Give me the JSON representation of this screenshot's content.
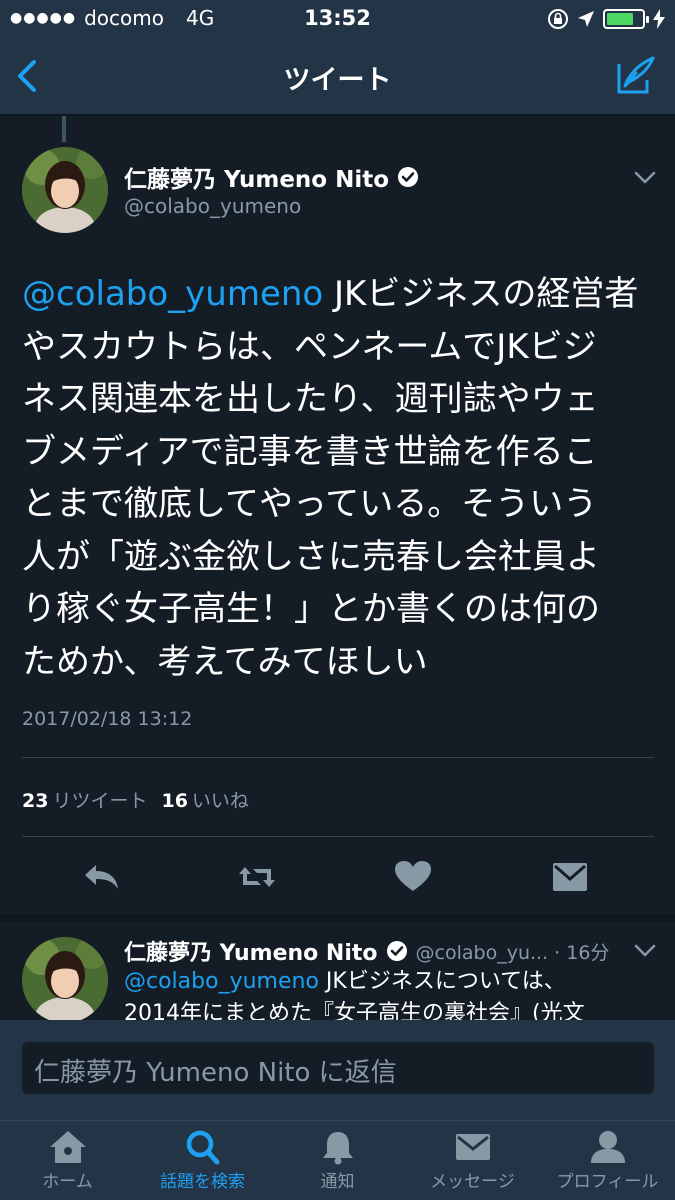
{
  "status_bar": {
    "carrier": "docomo",
    "network": "4G",
    "time": "13:52",
    "battery_level": 0.75
  },
  "nav": {
    "title": "ツイート",
    "back_icon": "chevron-left-icon",
    "compose_icon": "compose-tweet-icon"
  },
  "tweet": {
    "display_name": "仁藤夢乃 Yumeno Nito",
    "handle": "@colabo_yumeno",
    "mention": "@colabo_yumeno",
    "text_lines": [
      " JKビジネスの経営者",
      "やスカウトらは、ペンネームでJKビジ",
      "ネス関連本を出したり、週刊誌やウェ",
      "ブメディアで記事を書き世論を作るこ",
      "とまで徹底してやっている。そういう",
      "人が「遊ぶ金欲しさに売春し会社員よ",
      "り稼ぐ女子高生！」とか書くのは何の",
      "ためか、考えてみてほしい"
    ],
    "timestamp": "2017/02/18 13:12",
    "retweets_count": "23",
    "retweets_label": "リツイート",
    "likes_count": "16",
    "likes_label": "いいね"
  },
  "reply_tweet": {
    "display_name": "仁藤夢乃 Yumeno Nito",
    "handle_time": "@colabo_yu... · 16分",
    "mention": "@colabo_yumeno",
    "line1": " JKビジネスについては、",
    "line2": "2014年にまとめた『女子高生の裏社会』(光文"
  },
  "reply_input": {
    "placeholder": "仁藤夢乃 Yumeno Nito に返信"
  },
  "tabs": [
    {
      "label": "ホーム",
      "icon": "home-icon",
      "active": false
    },
    {
      "label": "話題を検索",
      "icon": "search-icon",
      "active": true
    },
    {
      "label": "通知",
      "icon": "bell-icon",
      "active": false
    },
    {
      "label": "メッセージ",
      "icon": "envelope-icon",
      "active": false
    },
    {
      "label": "プロフィール",
      "icon": "person-icon",
      "active": false
    }
  ],
  "colors": {
    "background": "#141d26",
    "bar": "#243447",
    "accent": "#1da1f2",
    "muted": "#8899a6"
  }
}
